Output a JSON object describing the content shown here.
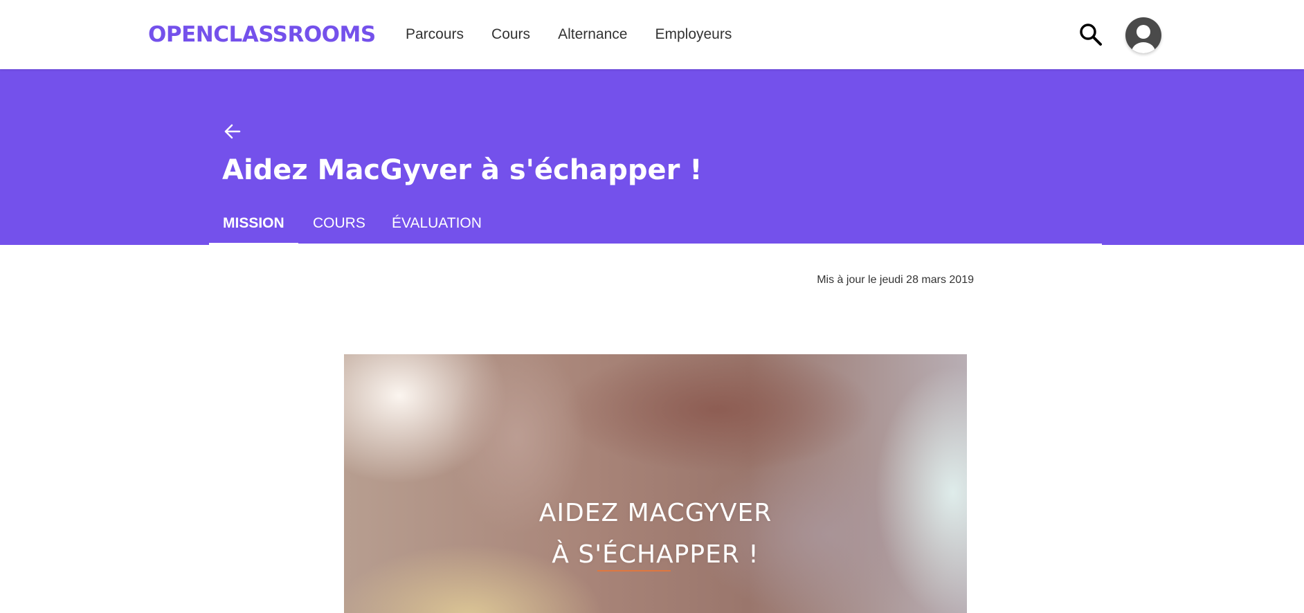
{
  "brand": {
    "logo_text": "OPENCLASSROOMS",
    "accent_color": "#7451eb"
  },
  "nav": {
    "links": [
      "Parcours",
      "Cours",
      "Alternance",
      "Employeurs"
    ],
    "search_icon": "search-icon",
    "avatar_icon": "user-avatar-icon"
  },
  "hero": {
    "back_icon": "arrow-left-icon",
    "title": "Aidez MacGyver à s'échapper !",
    "tabs": [
      {
        "label": "MISSION",
        "active": true
      },
      {
        "label": "COURS",
        "active": false
      },
      {
        "label": "ÉVALUATION",
        "active": false
      }
    ]
  },
  "content": {
    "updated_text": "Mis à jour le jeudi 28 mars 2019",
    "video": {
      "line1": "AIDEZ MACGYVER",
      "line2": "À S'ÉCHAPPER !"
    }
  }
}
